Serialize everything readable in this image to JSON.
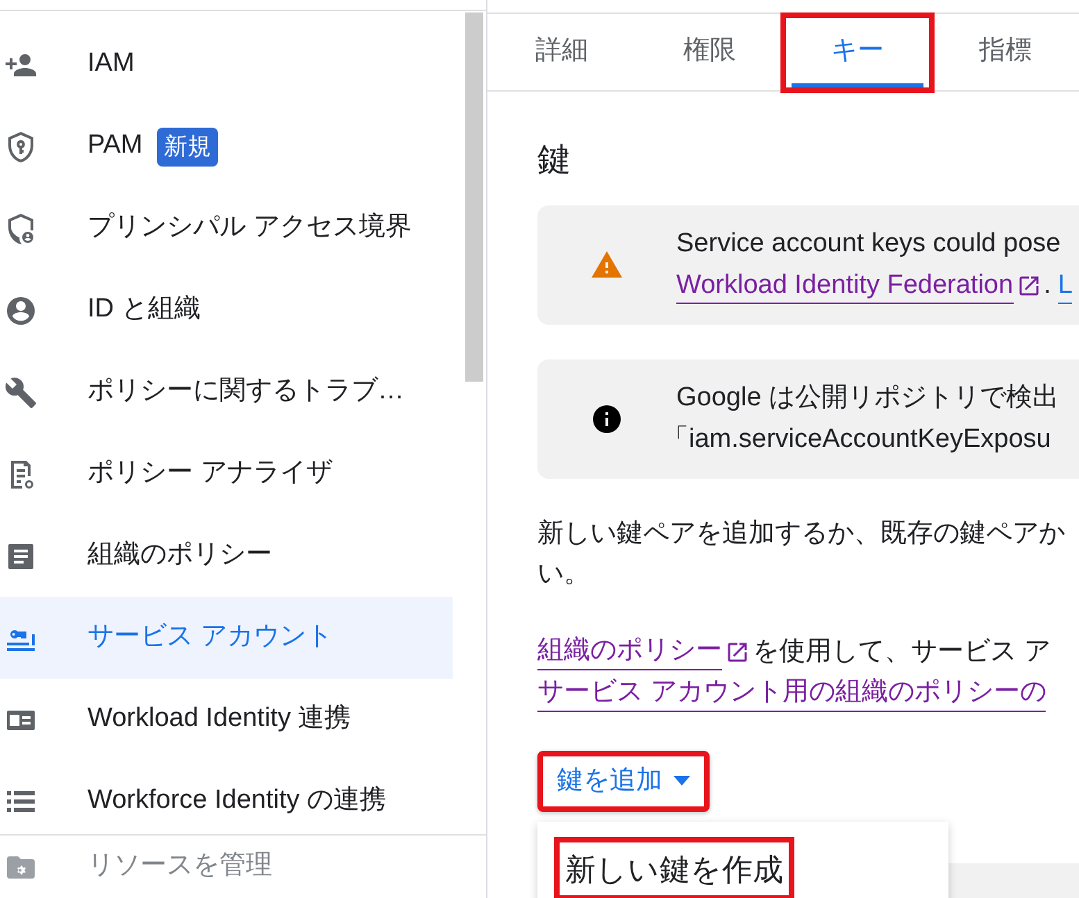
{
  "sidebar": {
    "items": [
      {
        "label": "IAM",
        "selected": false
      },
      {
        "label": "PAM",
        "selected": false,
        "badge": "新規"
      },
      {
        "label": "プリンシパル アクセス境界",
        "selected": false
      },
      {
        "label": "ID と組織",
        "selected": false
      },
      {
        "label": "ポリシーに関するトラブ…",
        "selected": false
      },
      {
        "label": "ポリシー アナライザ",
        "selected": false
      },
      {
        "label": "組織のポリシー",
        "selected": false
      },
      {
        "label": "サービス アカウント",
        "selected": true
      },
      {
        "label": "Workload Identity 連携",
        "selected": false
      },
      {
        "label": "Workforce Identity の連携",
        "selected": false
      }
    ],
    "footer": {
      "label": "リソースを管理",
      "disabled": true
    }
  },
  "tabs": [
    {
      "label": "詳細",
      "selected": false,
      "annotated": false
    },
    {
      "label": "権限",
      "selected": false,
      "annotated": false
    },
    {
      "label": "キー",
      "selected": true,
      "annotated": true
    },
    {
      "label": "指標",
      "selected": false,
      "annotated": false
    }
  ],
  "heading": "鍵",
  "notices": [
    {
      "kind": "warning",
      "line1": "Service account keys could pose",
      "link": "Workload Identity Federation",
      "after": ".",
      "link2": "L"
    },
    {
      "kind": "info",
      "line1": "Google は公開リポジトリで検出",
      "line2": "「iam.serviceAccountKeyExposu"
    }
  ],
  "paragraph": {
    "line1": "新しい鍵ペアを追加するか、既存の鍵ペアか",
    "line2": "い。"
  },
  "policy": {
    "link": "組織のポリシー",
    "text": "を使用して、サービス ア",
    "link2": "サービス アカウント用の組織のポリシーの"
  },
  "add_button": {
    "label": "鍵を追加",
    "annotated": true
  },
  "menu": [
    {
      "label": "新しい鍵を作成",
      "annotated": true
    }
  ]
}
